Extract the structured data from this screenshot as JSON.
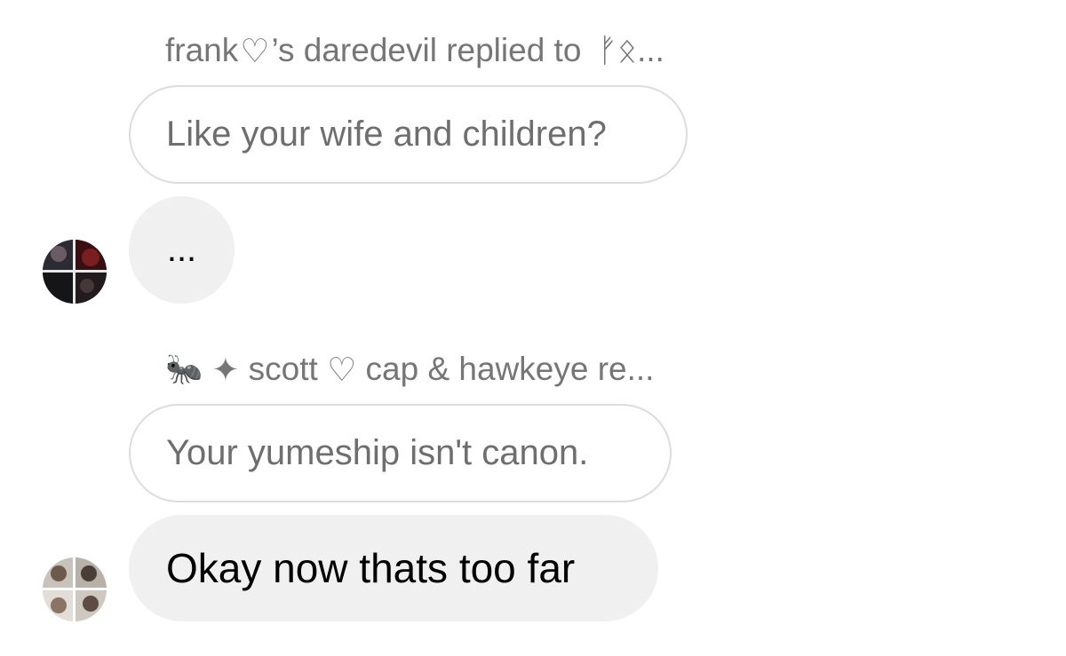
{
  "messages": [
    {
      "reply_header": {
        "sender": "frank ",
        "heart": "♡",
        "sender_suffix": "’s daredevil replied to ",
        "target": "ᚠᛟ..."
      },
      "quoted_text": "Like your wife and children?",
      "text": "..."
    },
    {
      "reply_header": {
        "emoji": "🐜",
        "star": "✦",
        "sender": " scott ",
        "heart": "♡",
        "rest": " cap & hawkeye re..."
      },
      "quoted_text": "Your yumeship isn't canon.",
      "text": "Okay now thats too far"
    }
  ],
  "colors": {
    "header_text": "#767676",
    "quoted_border": "#dcdcdc",
    "quoted_text": "#6e6e6e",
    "bubble_bg": "#f0f0f0",
    "message_text": "#000000"
  }
}
